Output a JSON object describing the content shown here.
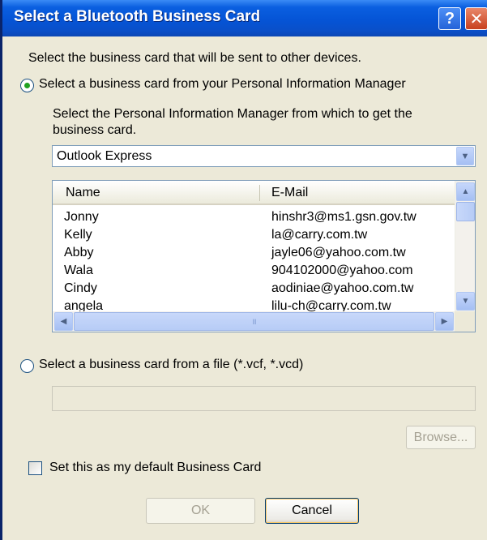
{
  "window": {
    "title": "Select a Bluetooth Business Card",
    "help_glyph": "?",
    "close_glyph": "✕"
  },
  "intro_text": "Select the business card that will be sent to other devices.",
  "option_pim": {
    "label": "Select a business card from your Personal Information Manager",
    "selected": true
  },
  "pim_select_label": "Select the Personal Information Manager from which to get the business card.",
  "pim_dropdown": {
    "selected": "Outlook Express",
    "arrow": "▼"
  },
  "contacts": {
    "columns": [
      "Name",
      "E-Mail"
    ],
    "rows": [
      {
        "name": "Jonny",
        "email": "hinshr3@ms1.gsn.gov.tw"
      },
      {
        "name": "Kelly",
        "email": "la@carry.com.tw"
      },
      {
        "name": "Abby",
        "email": "jayle06@yahoo.com.tw"
      },
      {
        "name": "Wala",
        "email": "904102000@yahoo.com"
      },
      {
        "name": "Cindy",
        "email": "aodiniae@yahoo.com.tw"
      },
      {
        "name": "angela",
        "email": "lilu-ch@carry.com.tw"
      }
    ],
    "scroll_up": "▲",
    "scroll_down": "▼",
    "scroll_left": "◀",
    "scroll_right": "▶",
    "hscroll_grip": "III"
  },
  "option_file": {
    "label": "Select a business card from a file (*.vcf, *.vcd)",
    "selected": false
  },
  "file_path_value": "",
  "browse_button": "Browse...",
  "default_checkbox": {
    "label": "Set this as my default Business Card",
    "checked": false
  },
  "ok_button": "OK",
  "cancel_button": "Cancel",
  "colors": {
    "titlebar": "#0554D6",
    "dialog_bg": "#ECE9D8",
    "radio_selected": "#21A121",
    "close_button": "#C8401E"
  }
}
